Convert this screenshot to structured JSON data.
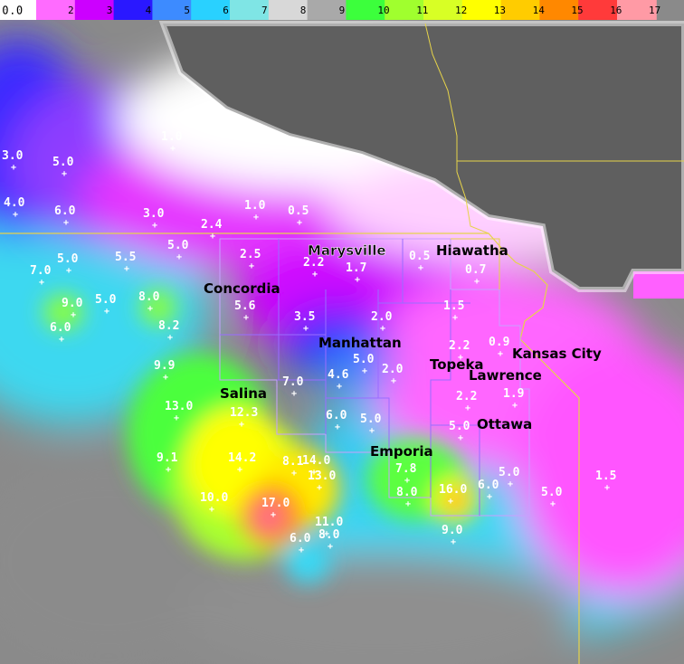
{
  "colorbar": {
    "start_label": "0.0",
    "ticks": [
      "2",
      "3",
      "4",
      "5",
      "6",
      "7",
      "8",
      "9",
      "10",
      "11",
      "12",
      "13",
      "14",
      "15",
      "16",
      "17"
    ],
    "colors": [
      "#ff6bff",
      "#cc00ff",
      "#2a18ff",
      "#3d8bff",
      "#29d1ff",
      "#7fe5e5",
      "#d8d8d8",
      "#a9a9a9",
      "#3cff3c",
      "#a0ff2e",
      "#d8ff25",
      "#ffff00",
      "#ffcc00",
      "#ff8800",
      "#ff3a3a",
      "#ff9aa5"
    ]
  },
  "cities": [
    {
      "name": "Marysville"
    },
    {
      "name": "Hiawatha"
    },
    {
      "name": "Concordia"
    },
    {
      "name": "Manhattan"
    },
    {
      "name": "Topeka"
    },
    {
      "name": "Kansas City"
    },
    {
      "name": "Lawrence"
    },
    {
      "name": "Salina"
    },
    {
      "name": "Ottawa"
    },
    {
      "name": "Emporia"
    }
  ],
  "values": [
    "3.0",
    "5.0",
    "1.0",
    "4.0",
    "6.0",
    "3.0",
    "1.0",
    "0.5",
    "2.4",
    "5.0",
    "7.0",
    "5.0",
    "5.5",
    "2.5",
    "2.2",
    "1.7",
    "0.5",
    "0.7",
    "9.0",
    "5.0",
    "8.0",
    "6.0",
    "5.6",
    "3.5",
    "2.0",
    "1.5",
    "8.2",
    "2.2",
    "0.9",
    "5.0",
    "9.9",
    "2.0",
    "4.6",
    "7.0",
    "13.0",
    "12.3",
    "6.0",
    "5.0",
    "2.2",
    "1.9",
    "5.0",
    "9.1",
    "14.2",
    "8.1",
    "14.0",
    "13.0",
    "7.8",
    "5.0",
    "10.0",
    "17.0",
    "8.0",
    "16.0",
    "6.0",
    "5.0",
    "1.5",
    "11.0",
    "6.0",
    "8.0",
    "9.0"
  ]
}
